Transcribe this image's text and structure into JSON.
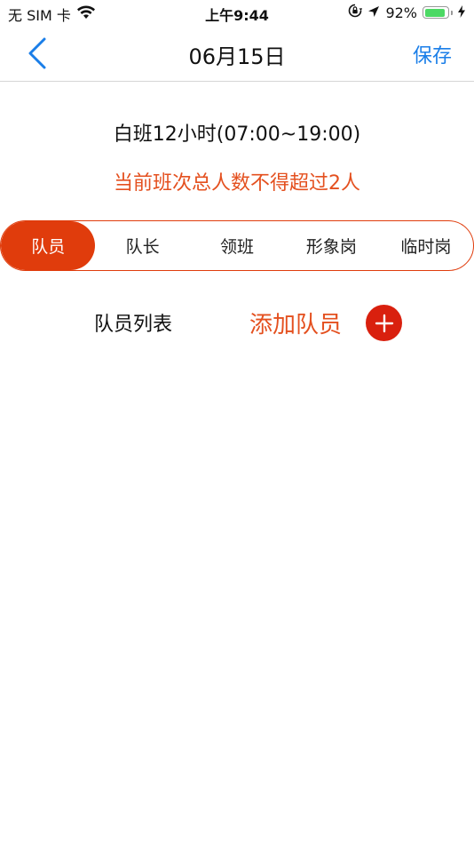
{
  "status_bar": {
    "carrier": "无 SIM 卡",
    "time": "上午9:44",
    "battery_percent_text": "92%",
    "battery_level": 0.92,
    "icons": [
      "wifi-icon",
      "orientation-lock-icon",
      "location-arrow-icon",
      "battery-icon",
      "charging-bolt-icon"
    ]
  },
  "nav": {
    "back_icon": "chevron-left-icon",
    "title": "06月15日",
    "save_label": "保存"
  },
  "shift": {
    "title": "白班12小时(07:00~19:00)",
    "warning": "当前班次总人数不得超过2人"
  },
  "tabs": [
    {
      "label": "队员",
      "active": true
    },
    {
      "label": "队长",
      "active": false
    },
    {
      "label": "领班",
      "active": false
    },
    {
      "label": "形象岗",
      "active": false
    },
    {
      "label": "临时岗",
      "active": false
    }
  ],
  "member_list": {
    "label": "队员列表",
    "add_label": "添加队员",
    "add_icon": "plus-circle-icon"
  },
  "colors": {
    "accent_blue": "#1a7ee8",
    "accent_orange": "#e4501f",
    "tab_active_bg": "#e03c0c",
    "add_button_bg": "#d9200e",
    "battery_green": "#4cd964",
    "divider": "#d6d6d6"
  }
}
